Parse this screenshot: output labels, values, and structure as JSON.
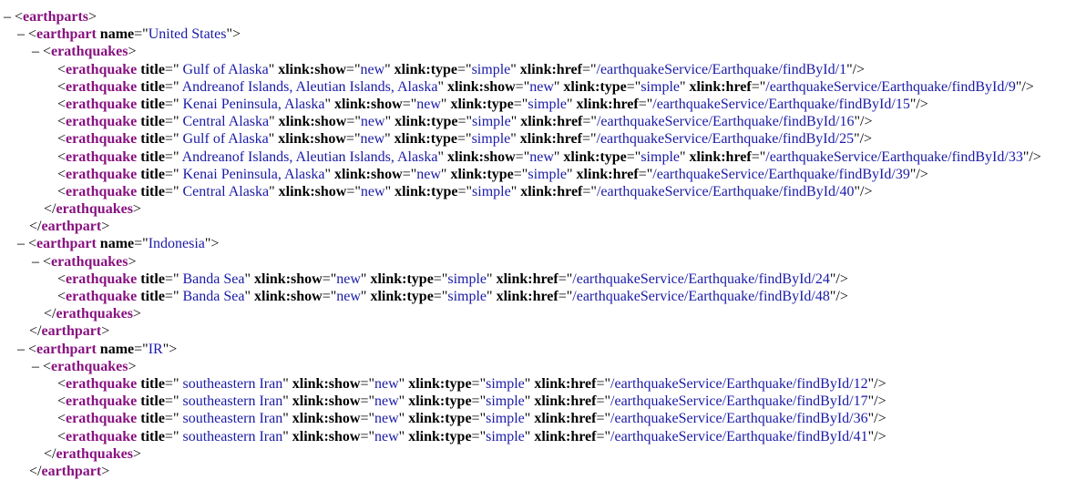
{
  "toggle_glyph": "–",
  "root_tag": "earthparts",
  "element_tags": {
    "part": "earthpart",
    "group": "erathquakes",
    "item": "erathquake"
  },
  "attribute_names": {
    "name": "name",
    "title": "title",
    "show": "xlink:show",
    "type": "xlink:type",
    "href": "xlink:href"
  },
  "earthparts": [
    {
      "name": "United States",
      "quakes": [
        {
          "title": " Gulf of Alaska",
          "show": "new",
          "type": "simple",
          "href": "/earthquakeService/Earthquake/findById/1"
        },
        {
          "title": " Andreanof Islands, Aleutian Islands, Alaska",
          "show": "new",
          "type": "simple",
          "href": "/earthquakeService/Earthquake/findById/9"
        },
        {
          "title": " Kenai Peninsula, Alaska",
          "show": "new",
          "type": "simple",
          "href": "/earthquakeService/Earthquake/findById/15"
        },
        {
          "title": " Central Alaska",
          "show": "new",
          "type": "simple",
          "href": "/earthquakeService/Earthquake/findById/16"
        },
        {
          "title": " Gulf of Alaska",
          "show": "new",
          "type": "simple",
          "href": "/earthquakeService/Earthquake/findById/25"
        },
        {
          "title": " Andreanof Islands, Aleutian Islands, Alaska",
          "show": "new",
          "type": "simple",
          "href": "/earthquakeService/Earthquake/findById/33"
        },
        {
          "title": " Kenai Peninsula, Alaska",
          "show": "new",
          "type": "simple",
          "href": "/earthquakeService/Earthquake/findById/39"
        },
        {
          "title": " Central Alaska",
          "show": "new",
          "type": "simple",
          "href": "/earthquakeService/Earthquake/findById/40"
        }
      ]
    },
    {
      "name": "Indonesia",
      "quakes": [
        {
          "title": " Banda Sea",
          "show": "new",
          "type": "simple",
          "href": "/earthquakeService/Earthquake/findById/24"
        },
        {
          "title": " Banda Sea",
          "show": "new",
          "type": "simple",
          "href": "/earthquakeService/Earthquake/findById/48"
        }
      ]
    },
    {
      "name": "IR",
      "quakes": [
        {
          "title": " southeastern Iran",
          "show": "new",
          "type": "simple",
          "href": "/earthquakeService/Earthquake/findById/12"
        },
        {
          "title": " southeastern Iran",
          "show": "new",
          "type": "simple",
          "href": "/earthquakeService/Earthquake/findById/17"
        },
        {
          "title": " southeastern Iran",
          "show": "new",
          "type": "simple",
          "href": "/earthquakeService/Earthquake/findById/36"
        },
        {
          "title": " southeastern Iran",
          "show": "new",
          "type": "simple",
          "href": "/earthquakeService/Earthquake/findById/41"
        }
      ]
    }
  ],
  "colors": {
    "tag": "#881280",
    "attribute": "#000000",
    "value": "#1a1aa6"
  }
}
